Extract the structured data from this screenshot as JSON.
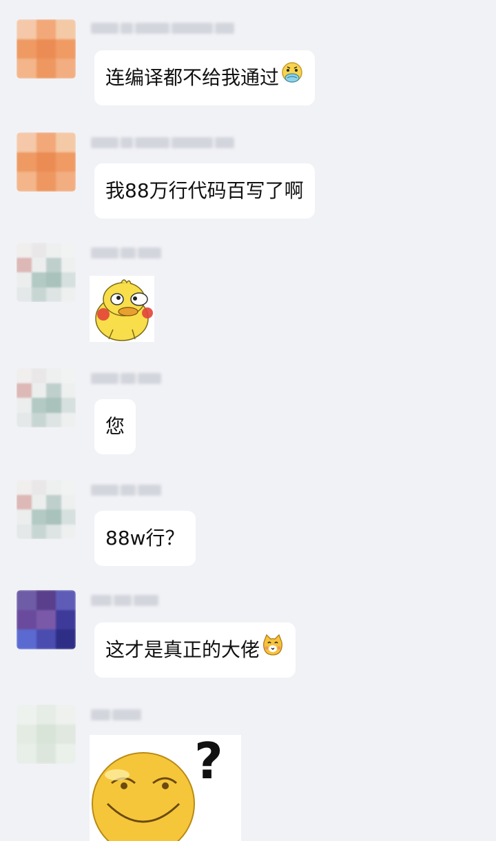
{
  "messages": [
    {
      "text": "连编译都不给我通过",
      "emoji": "sick-face-emoji"
    },
    {
      "text": "我88万行代码百写了啊"
    },
    {
      "sticker": "yellow-duck-sticker"
    },
    {
      "text": "您"
    },
    {
      "text": "88w行？"
    },
    {
      "text": "这才是真正的大佬",
      "emoji": "cat-face-emoji"
    },
    {
      "sticker": "smiling-face-question-sticker",
      "sticker_text": "?"
    }
  ]
}
